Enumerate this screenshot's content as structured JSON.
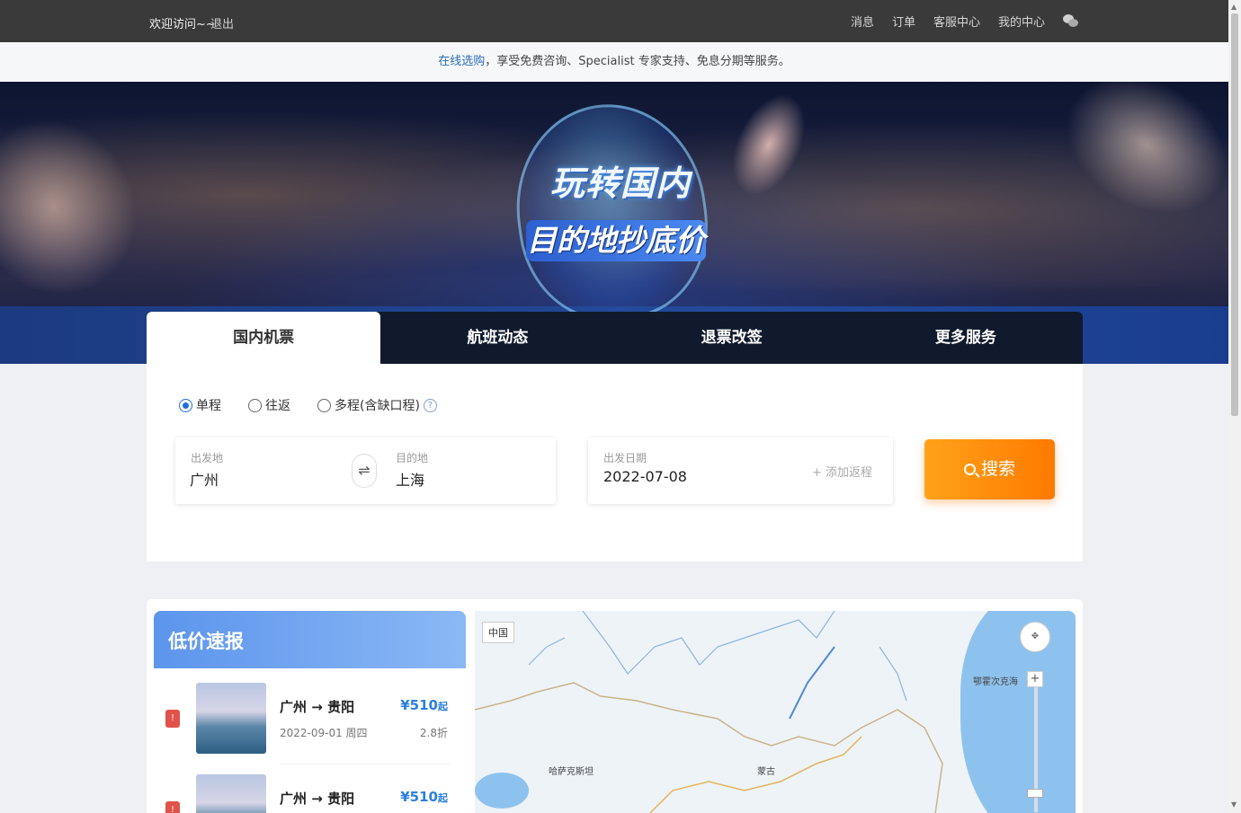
{
  "topbar": {
    "welcome": "欢迎访问~~",
    "logout": "退出",
    "nav": [
      "消息",
      "订单",
      "客服中心",
      "我的中心"
    ]
  },
  "notice": {
    "link": "在线选购",
    "text": "，享受免费咨询、Specialist 专家支持、免息分期等服务。"
  },
  "banner": {
    "title1": "玩转国内",
    "title2": "目的地抄底价"
  },
  "tabs": [
    "国内机票",
    "航班动态",
    "退票改签",
    "更多服务"
  ],
  "search": {
    "trip_types": [
      "单程",
      "往返",
      "多程(含缺口程)"
    ],
    "help": "?",
    "from_label": "出发地",
    "from_value": "广州",
    "to_label": "目的地",
    "to_value": "上海",
    "swap": "⇌",
    "date_label": "出发日期",
    "date_value": "2022-07-08",
    "add_return": "+ 添加返程",
    "button": "搜索"
  },
  "deals": {
    "title": "低价速报",
    "items": [
      {
        "rank": "!",
        "route_from": "广州",
        "arrow": "→",
        "route_to": "贵阳",
        "date": "2022-09-01 周四",
        "price": "¥510",
        "price_suffix": "起",
        "discount": "2.8折"
      },
      {
        "rank": "!",
        "route_from": "广州",
        "arrow": "→",
        "route_to": "贵阳",
        "date": "",
        "price": "¥510",
        "price_suffix": "起",
        "discount": ""
      }
    ]
  },
  "map": {
    "region": "中国",
    "labels": [
      "哈萨克斯坦",
      "蒙古",
      "鄂霍次克海"
    ],
    "zoom_plus": "+"
  }
}
